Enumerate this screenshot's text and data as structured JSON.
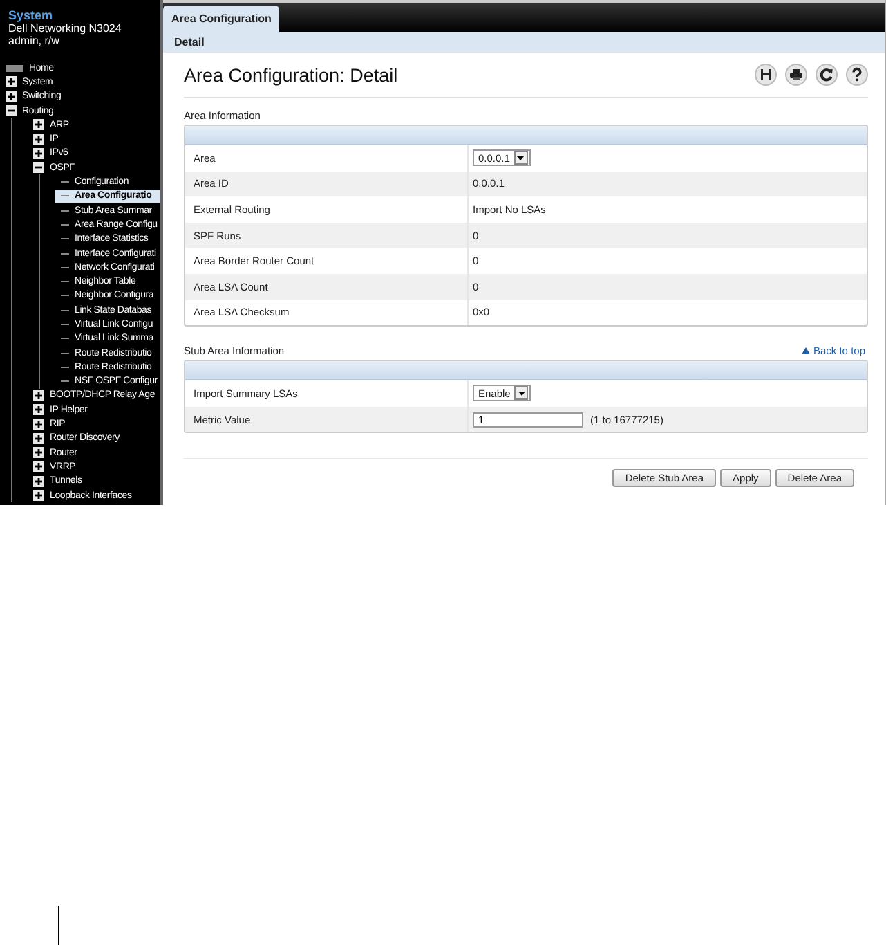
{
  "sidebar": {
    "title": "System",
    "device": "Dell Networking N3024",
    "user": "admin, r/w",
    "tree": [
      {
        "label": "Home",
        "kind": "root",
        "selected": false
      },
      {
        "label": "System",
        "kind": "folder",
        "expanded": false,
        "selected": false
      },
      {
        "label": "Switching",
        "kind": "folder",
        "expanded": false,
        "selected": false
      },
      {
        "label": "Routing",
        "kind": "folder",
        "expanded": true,
        "selected": false,
        "children": [
          {
            "label": "ARP",
            "kind": "folder",
            "expanded": false,
            "selected": false
          },
          {
            "label": "IP",
            "kind": "folder",
            "expanded": false,
            "selected": false
          },
          {
            "label": "IPv6",
            "kind": "folder",
            "expanded": false,
            "selected": false
          },
          {
            "label": "OSPF",
            "kind": "folder",
            "expanded": true,
            "selected": false,
            "children": [
              {
                "label": "Configuration",
                "kind": "page",
                "selected": false
              },
              {
                "label": "Area Configuratio",
                "kind": "page",
                "selected": true
              },
              {
                "label": "Stub Area Summar",
                "kind": "page",
                "selected": false
              },
              {
                "label": "Area Range Configu",
                "kind": "page",
                "selected": false
              },
              {
                "label": "Interface Statistics",
                "kind": "page",
                "selected": false
              },
              {
                "label": "Interface Configurati",
                "kind": "page",
                "selected": false
              },
              {
                "label": "Network Configurati",
                "kind": "page",
                "selected": false
              },
              {
                "label": "Neighbor Table",
                "kind": "page",
                "selected": false
              },
              {
                "label": "Neighbor Configura",
                "kind": "page",
                "selected": false
              },
              {
                "label": "Link State Databas",
                "kind": "page",
                "selected": false
              },
              {
                "label": "Virtual Link Configu",
                "kind": "page",
                "selected": false
              },
              {
                "label": "Virtual Link Summa",
                "kind": "page",
                "selected": false
              },
              {
                "label": "Route Redistributio",
                "kind": "page",
                "selected": false
              },
              {
                "label": "Route Redistributio",
                "kind": "page",
                "selected": false
              },
              {
                "label": "NSF OSPF Configur",
                "kind": "page",
                "selected": false
              }
            ]
          },
          {
            "label": "BOOTP/DHCP Relay Age",
            "kind": "folder",
            "expanded": false,
            "selected": false
          },
          {
            "label": "IP Helper",
            "kind": "folder",
            "expanded": false,
            "selected": false
          },
          {
            "label": "RIP",
            "kind": "folder",
            "expanded": false,
            "selected": false
          },
          {
            "label": "Router Discovery",
            "kind": "folder",
            "expanded": false,
            "selected": false
          },
          {
            "label": "Router",
            "kind": "folder",
            "expanded": false,
            "selected": false
          },
          {
            "label": "VRRP",
            "kind": "folder",
            "expanded": false,
            "selected": false
          },
          {
            "label": "Tunnels",
            "kind": "folder",
            "expanded": false,
            "selected": false
          },
          {
            "label": "Loopback Interfaces",
            "kind": "folder",
            "expanded": false,
            "selected": false
          }
        ]
      }
    ]
  },
  "tabs": [
    {
      "label": "Area Configuration",
      "selected": true
    }
  ],
  "subtabs": [
    {
      "label": "Detail",
      "selected": true
    }
  ],
  "page_title": "Area Configuration: Detail",
  "sections": [
    {
      "title": "Area Information",
      "rows": [
        {
          "label": "Area",
          "kind": "select",
          "value": "0.0.0.1"
        },
        {
          "label": "Area ID",
          "kind": "text",
          "value": "0.0.0.1"
        },
        {
          "label": "External Routing",
          "kind": "text",
          "value": "Import No LSAs"
        },
        {
          "label": "SPF Runs",
          "kind": "text",
          "value": "0"
        },
        {
          "label": "Area Border Router Count",
          "kind": "text",
          "value": "0"
        },
        {
          "label": "Area LSA Count",
          "kind": "text",
          "value": "0"
        },
        {
          "label": "Area LSA Checksum",
          "kind": "text",
          "value": "0x0"
        }
      ]
    },
    {
      "title": "Stub Area Information",
      "link": "Back to top",
      "rows": [
        {
          "label": "Import Summary LSAs",
          "kind": "select",
          "value": "Enable"
        },
        {
          "label": "Metric Value",
          "kind": "input",
          "value": "1",
          "hint": "(1 to 16777215)"
        }
      ]
    }
  ],
  "buttons": [
    "Delete Stub Area",
    "Apply",
    "Delete Area"
  ]
}
